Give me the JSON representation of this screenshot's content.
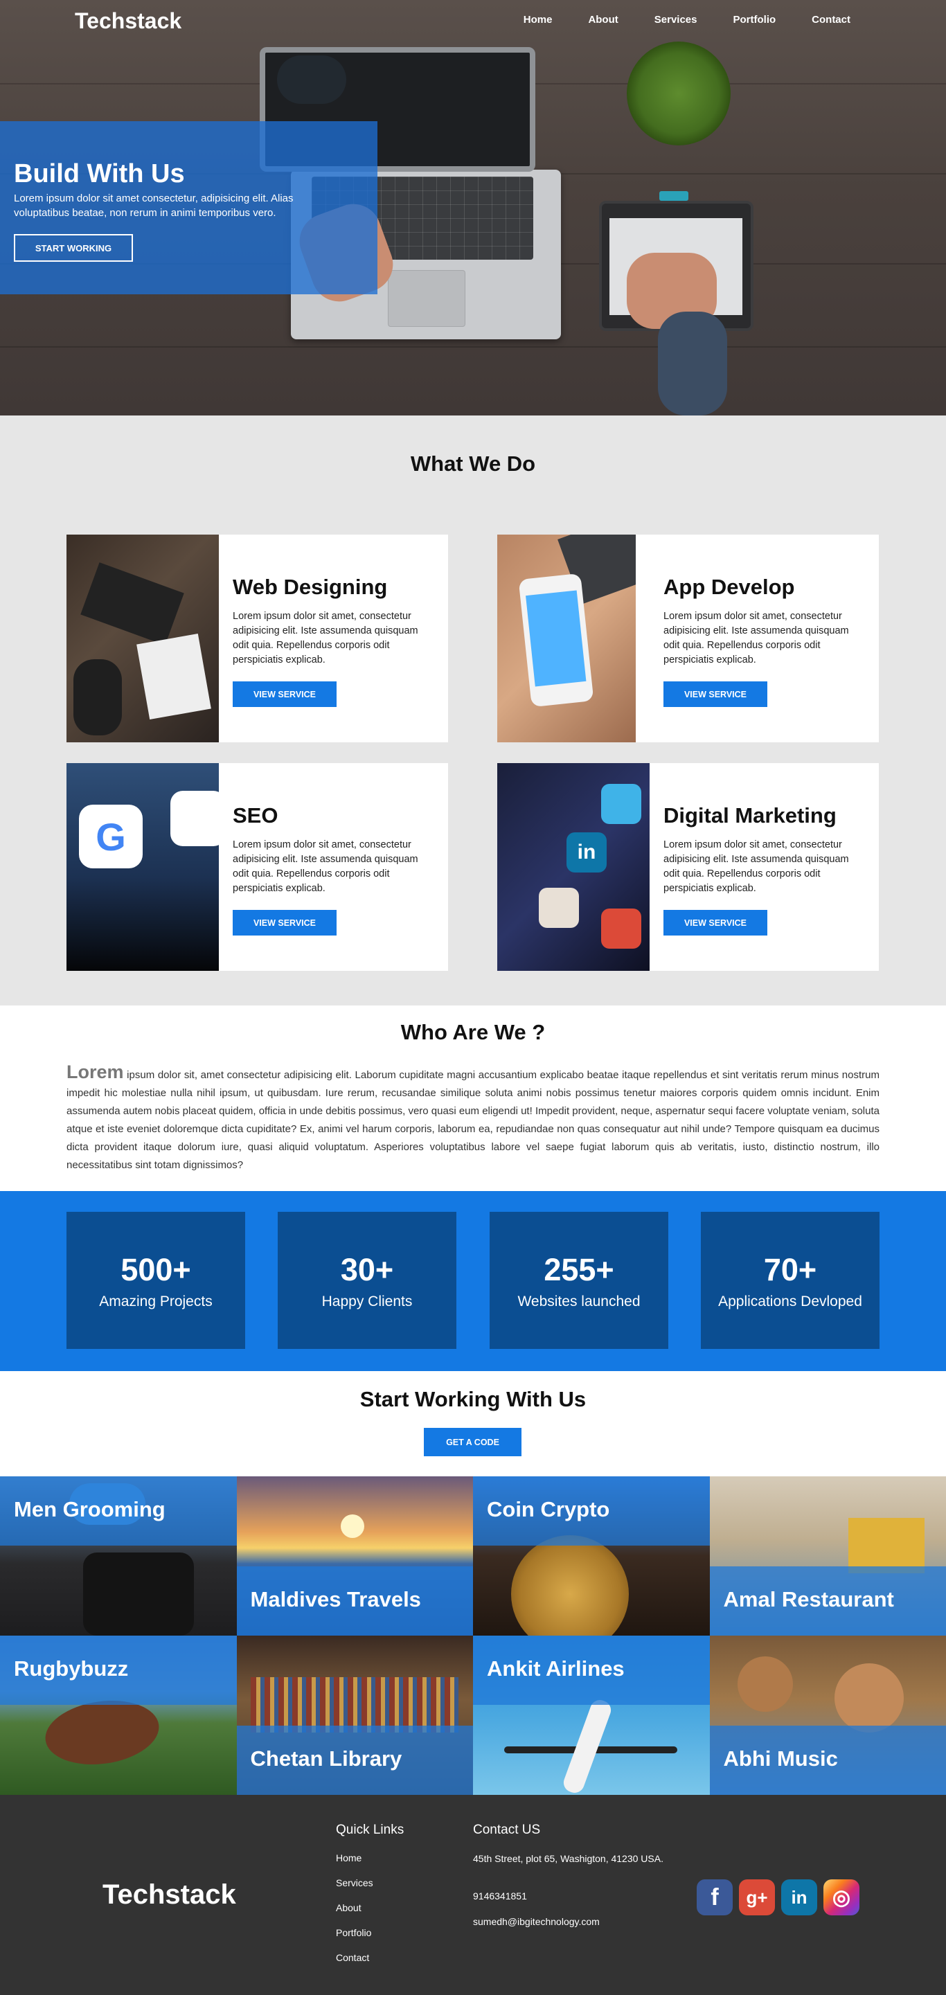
{
  "nav": {
    "brand": "Techstack",
    "links": [
      "Home",
      "About",
      "Services",
      "Portfolio",
      "Contact"
    ]
  },
  "hero": {
    "title": "Build With Us",
    "subtitle": "Lorem ipsum dolor sit amet consectetur, adipisicing elit. Alias voluptatibus beatae, non rerum in animi temporibus vero.",
    "button": "START WORKING",
    "overlay_color": "#1e6ed2"
  },
  "what_we_do": {
    "title": "What We Do",
    "cards": [
      {
        "title": "Web Designing",
        "text": "Lorem ipsum dolor sit amet, consectetur adipisicing elit. Iste assumenda quisquam odit quia. Repellendus corporis odit perspiciatis explicab.",
        "button": "VIEW SERVICE"
      },
      {
        "title": "App Develop",
        "text": "Lorem ipsum dolor sit amet, consectetur adipisicing elit. Iste assumenda quisquam odit quia. Repellendus corporis odit perspiciatis explicab.",
        "button": "VIEW SERVICE"
      },
      {
        "title": "SEO",
        "text": "Lorem ipsum dolor sit amet, consectetur adipisicing elit. Iste assumenda quisquam odit quia. Repellendus corporis odit perspiciatis explicab.",
        "button": "VIEW SERVICE"
      },
      {
        "title": "Digital Marketing",
        "text": "Lorem ipsum dolor sit amet, consectetur adipisicing elit. Iste assumenda quisquam odit quia. Repellendus corporis odit perspiciatis explicab.",
        "button": "VIEW SERVICE"
      }
    ]
  },
  "who": {
    "title": "Who Are We ?",
    "lead": "Lorem",
    "text": " ipsum dolor sit, amet consectetur adipisicing elit. Laborum cupiditate magni accusantium explicabo beatae itaque repellendus et sint veritatis rerum minus nostrum impedit hic molestiae nulla nihil ipsum, ut quibusdam. Iure rerum, recusandae similique soluta animi nobis possimus tenetur maiores corporis quidem omnis incidunt. Enim assumenda autem nobis placeat quidem, officia in unde debitis possimus, vero quasi eum eligendi ut! Impedit provident, neque, aspernatur sequi facere voluptate veniam, soluta atque et iste eveniet doloremque dicta cupiditate? Ex, animi vel harum corporis, laborum ea, repudiandae non quas consequatur aut nihil unde? Tempore quisquam ea ducimus dicta provident itaque dolorum iure, quasi aliquid voluptatum. Asperiores voluptatibus labore vel saepe fugiat laborum quis ab veritatis, iusto, distinctio nostrum, illo necessitatibus sint totam dignissimos?"
  },
  "stats": [
    {
      "num": "500+",
      "label": "Amazing Projects"
    },
    {
      "num": "30+",
      "label": "Happy Clients"
    },
    {
      "num": "255+",
      "label": "Websites launched"
    },
    {
      "num": "70+",
      "label": "Applications Devloped"
    }
  ],
  "cta": {
    "title": "Start Working With Us",
    "button": "GET A CODE"
  },
  "portfolio": [
    {
      "name": "Men Grooming"
    },
    {
      "name": "Maldives Travels"
    },
    {
      "name": "Coin Crypto"
    },
    {
      "name": "Amal Restaurant"
    },
    {
      "name": "Rugbybuzz"
    },
    {
      "name": "Chetan Library"
    },
    {
      "name": "Ankit Airlines"
    },
    {
      "name": "Abhi Music"
    }
  ],
  "footer": {
    "brand": "Techstack",
    "quick_links_title": "Quick Links",
    "quick_links": [
      "Home",
      "Services",
      "About",
      "Portfolio",
      "Contact"
    ],
    "contact_title": "Contact US",
    "address": "45th Street, plot 65, Washigton, 41230 USA.",
    "phone": "9146341851",
    "email": "sumedh@ibgitechnology.com",
    "social": [
      {
        "icon": "facebook-icon",
        "glyph": "f",
        "color": "#3b5998"
      },
      {
        "icon": "google-plus-icon",
        "glyph": "g+",
        "color": "#dc4a38"
      },
      {
        "icon": "linkedin-icon",
        "glyph": "in",
        "color": "#0e76a8"
      },
      {
        "icon": "instagram-icon",
        "glyph": "◎",
        "color": "#c13584"
      }
    ]
  }
}
